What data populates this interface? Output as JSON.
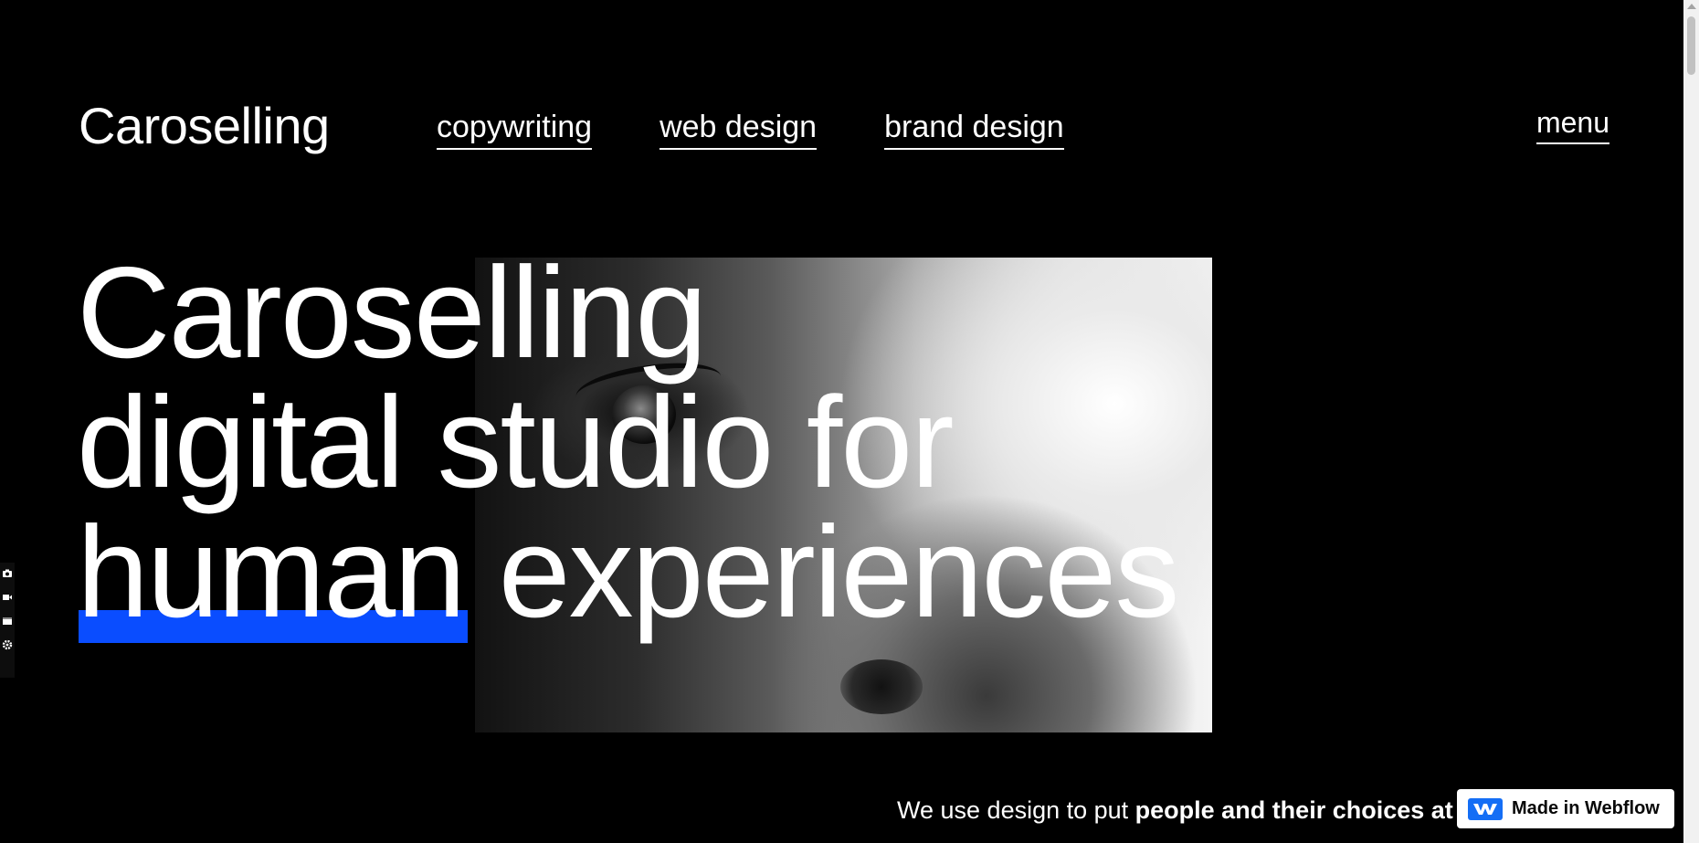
{
  "brand": {
    "logo_text": "Caroselling"
  },
  "nav": {
    "items": [
      {
        "label": "copywriting"
      },
      {
        "label": "web design"
      },
      {
        "label": "brand design"
      }
    ],
    "menu_label": "menu"
  },
  "hero": {
    "headline_line1": "Caroselling",
    "headline_line2": "digital studio for",
    "headline_highlight": "human",
    "headline_line3_rest": "experiences",
    "image_icon": "grayscale-face-closeup-image"
  },
  "tagline": {
    "prefix": "We use design to put ",
    "bold": "people and their choices at"
  },
  "badge": {
    "label": "Made in Webflow",
    "icon": "webflow-icon"
  },
  "toolstrip": {
    "icons": [
      "camera-icon",
      "video-icon",
      "window-icon",
      "gear-icon"
    ]
  },
  "colors": {
    "background": "#000000",
    "text": "#ffffff",
    "highlight": "#0a4dff",
    "webflow_blue": "#146ef5"
  }
}
